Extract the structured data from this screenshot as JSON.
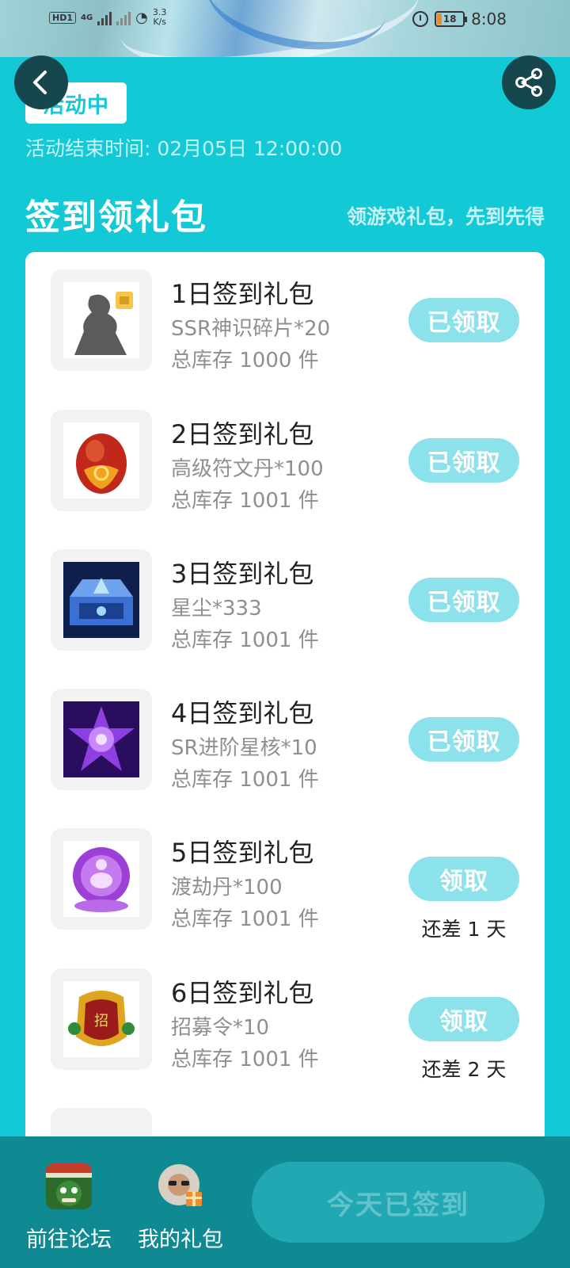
{
  "status_bar": {
    "hd_label": "HD",
    "sim_label": "1",
    "net_label": "4G",
    "speed_value": "3.3",
    "speed_unit": "K/s",
    "battery": "18",
    "time": "8:08"
  },
  "header": {
    "status_badge": "活动中",
    "end_time": "活动结束时间: 02月05日 12:00:00",
    "section_title": "签到领礼包",
    "section_subtitle": "领游戏礼包，先到先得"
  },
  "gifts": [
    {
      "name": "1日签到礼包",
      "item": "SSR神识碎片*20",
      "stock": "总库存 1000 件",
      "button": "已领取",
      "days_left": ""
    },
    {
      "name": "2日签到礼包",
      "item": "高级符文丹*100",
      "stock": "总库存 1001 件",
      "button": "已领取",
      "days_left": ""
    },
    {
      "name": "3日签到礼包",
      "item": "星尘*333",
      "stock": "总库存 1001 件",
      "button": "已领取",
      "days_left": ""
    },
    {
      "name": "4日签到礼包",
      "item": "SR进阶星核*10",
      "stock": "总库存 1001 件",
      "button": "已领取",
      "days_left": ""
    },
    {
      "name": "5日签到礼包",
      "item": "渡劫丹*100",
      "stock": "总库存 1001 件",
      "button": "领取",
      "days_left": "还差 1 天"
    },
    {
      "name": "6日签到礼包",
      "item": "招募令*10",
      "stock": "总库存 1001 件",
      "button": "领取",
      "days_left": "还差 2 天"
    }
  ],
  "bottom_bar": {
    "forum_label": "前往论坛",
    "my_gifts_label": "我的礼包",
    "sign_button": "今天已签到"
  },
  "colors": {
    "page_bg": "#13c9d5",
    "claimed_button": "#8be2ea",
    "bottom_bar": "#0f8a93"
  }
}
